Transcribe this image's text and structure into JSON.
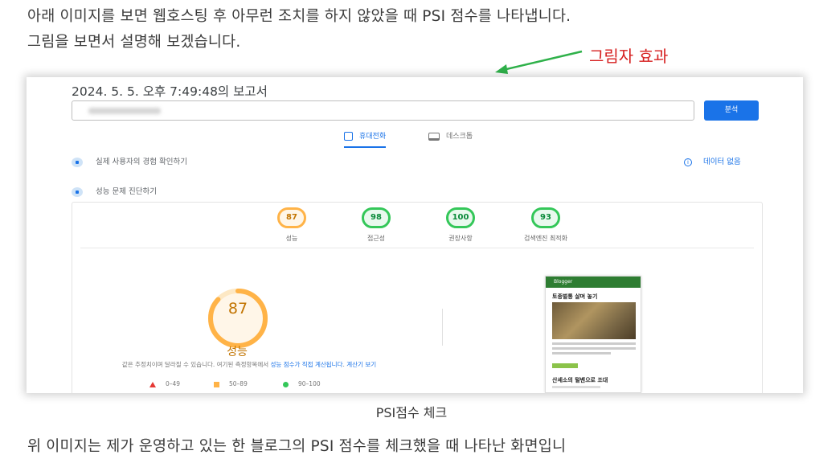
{
  "article": {
    "intro_line1": "아래 이미지를 보면 웹호스팅 후 아무런 조치를 하지 않았을 때 PSI 점수를 나타냅니다.",
    "intro_line2": "그림을 보면서 설명해 보겠습니다.",
    "annotation_label": "그림자 효과",
    "annotation_color": "#d61f1f",
    "caption": "PSI점수 체크",
    "bottom_line": "위 이미지는 제가 운영하고 있는 한 블로그의 PSI 점수를 체크했을 때 나타난 화면입니"
  },
  "report": {
    "title": "2024. 5. 5. 오후 7:49:48의 보고서",
    "analyze_button": "분석",
    "tabs": [
      {
        "label": "휴대전화",
        "active": true,
        "icon": "mobile-icon"
      },
      {
        "label": "데스크톱",
        "active": false,
        "icon": "desktop-icon"
      }
    ],
    "field_data_heading": "실제 사용자의 경험 확인하기",
    "no_data_label": "데이터 없음",
    "diagnose_heading": "성능 문제 진단하기",
    "scores": [
      {
        "label": "성능",
        "value": "87",
        "color": "#ffb347"
      },
      {
        "label": "접근성",
        "value": "98",
        "color": "#34c759"
      },
      {
        "label": "권장사항",
        "value": "100",
        "color": "#34c759"
      },
      {
        "label": "검색엔진 최적화",
        "value": "93",
        "color": "#34c759"
      }
    ],
    "main_score": {
      "value": "87",
      "label": "성능",
      "fraction": 0.87,
      "color": "#ffb347"
    },
    "note_prefix": "값은 추정치이며 달라질 수 있습니다. 여기된 측정항목에서 ",
    "note_link1": "성능 점수가 직접 계산됩니다",
    "note_mid": ". ",
    "note_link2": "계산기 보기",
    "legend": [
      {
        "range": "0–49",
        "color": "#e53935",
        "shape": "triangle"
      },
      {
        "range": "50–89",
        "color": "#ffb347",
        "shape": "square"
      },
      {
        "range": "90–100",
        "color": "#34c759",
        "shape": "circle"
      }
    ],
    "preview": {
      "brand": "Blogger",
      "post_title": "토종벌통 살며 놓기",
      "next_title": "산세소의 털벤으로 조대"
    }
  }
}
